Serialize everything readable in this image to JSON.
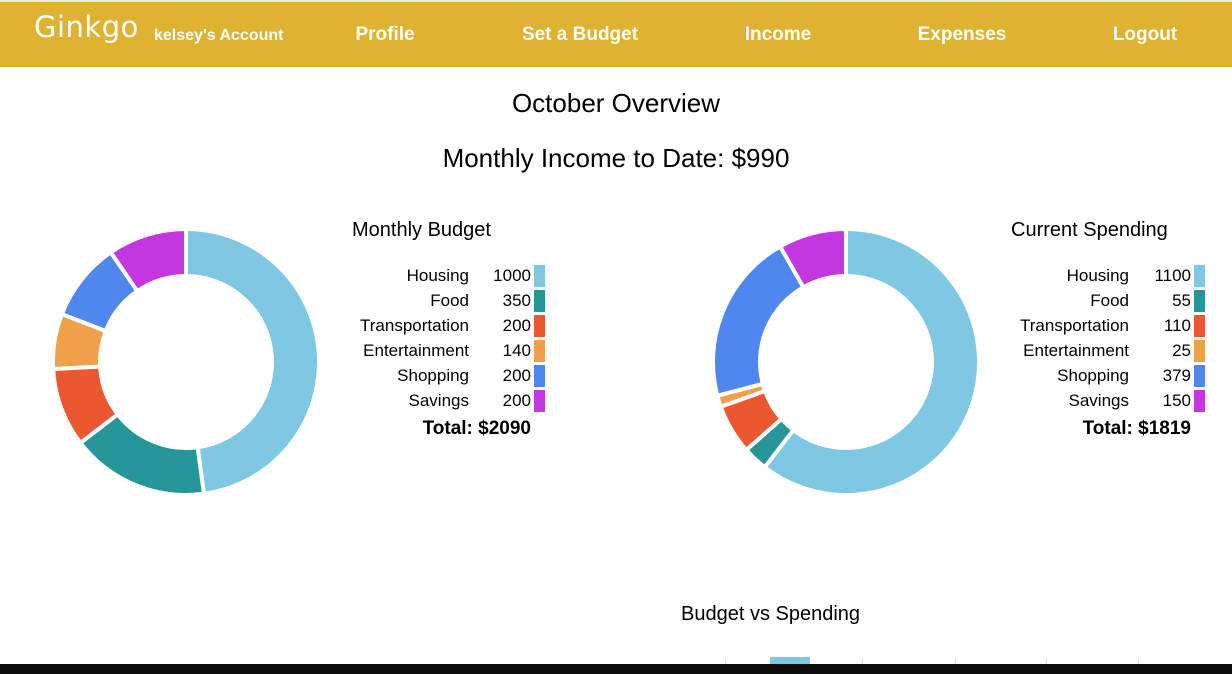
{
  "nav": {
    "brand": "Ginkgo",
    "account": "kelsey's Account",
    "links": [
      "Profile",
      "Set a Budget",
      "Income",
      "Expenses",
      "Logout"
    ],
    "background": "#dfb232"
  },
  "page": {
    "title": "October Overview",
    "income": "Monthly Income to Date: $990"
  },
  "chart_data": [
    {
      "type": "pie",
      "title": "Monthly Budget",
      "categories": [
        "Housing",
        "Food",
        "Transportation",
        "Entertainment",
        "Shopping",
        "Savings"
      ],
      "values": [
        1000,
        350,
        200,
        140,
        200,
        200
      ],
      "colors": [
        "#7ec8e3",
        "#25979a",
        "#ea5731",
        "#f0a04b",
        "#4f87ee",
        "#c336e0"
      ],
      "total": "Total: $2090"
    },
    {
      "type": "pie",
      "title": "Current Spending",
      "categories": [
        "Housing",
        "Food",
        "Transportation",
        "Entertainment",
        "Shopping",
        "Savings"
      ],
      "values": [
        1100,
        55,
        110,
        25,
        379,
        150
      ],
      "colors": [
        "#7ec8e3",
        "#25979a",
        "#ea5731",
        "#f0a04b",
        "#4f87ee",
        "#c336e0"
      ],
      "total": "Total: $1819"
    },
    {
      "type": "bar",
      "title": "Budget vs Spending"
    }
  ]
}
